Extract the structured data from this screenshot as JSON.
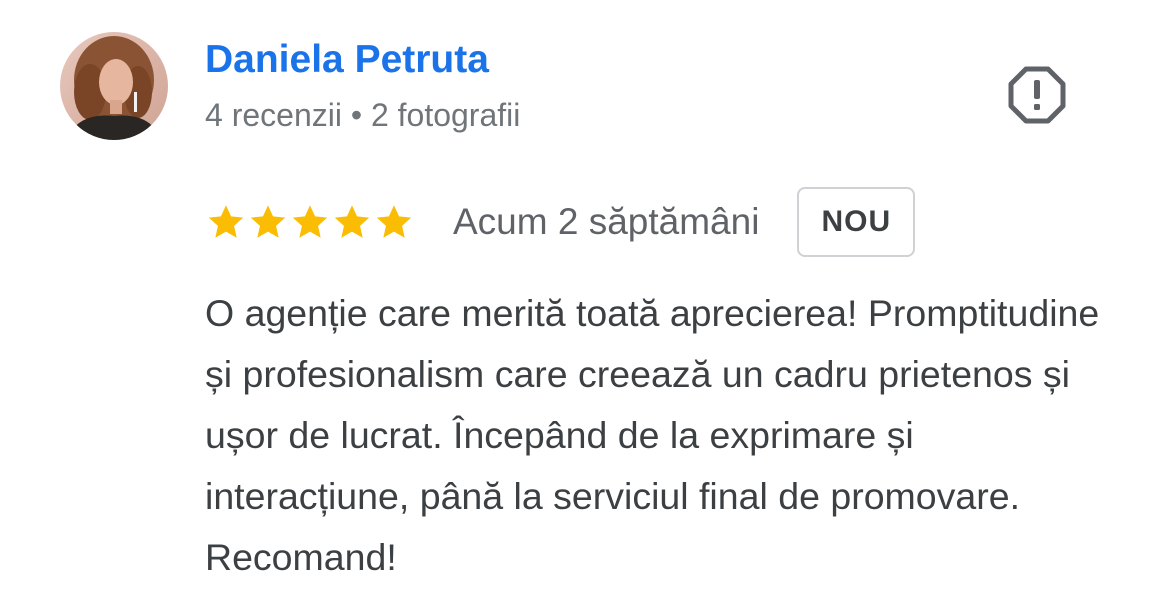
{
  "author": {
    "name": "Daniela Petruta",
    "meta": "4 recenzii • 2 fotografii",
    "avatar_icon": "profile-photo"
  },
  "report": {
    "icon": "report-icon"
  },
  "review": {
    "rating": 5,
    "rating_max": 5,
    "date": "Acum 2 săptămâni",
    "badge": "NOU",
    "text": "O agenție care merită toată aprecierea! Promptitudine și profesionalism care creează un cadru prietenos și ușor de lucrat. Începând de la exprimare și interacțiune, până la serviciul final de promovare. Recomand!"
  },
  "colors": {
    "name": "#1a73e8",
    "star": "#fbbc04",
    "meta": "#70757a",
    "text": "#3c4043",
    "icon": "#5f6368"
  }
}
